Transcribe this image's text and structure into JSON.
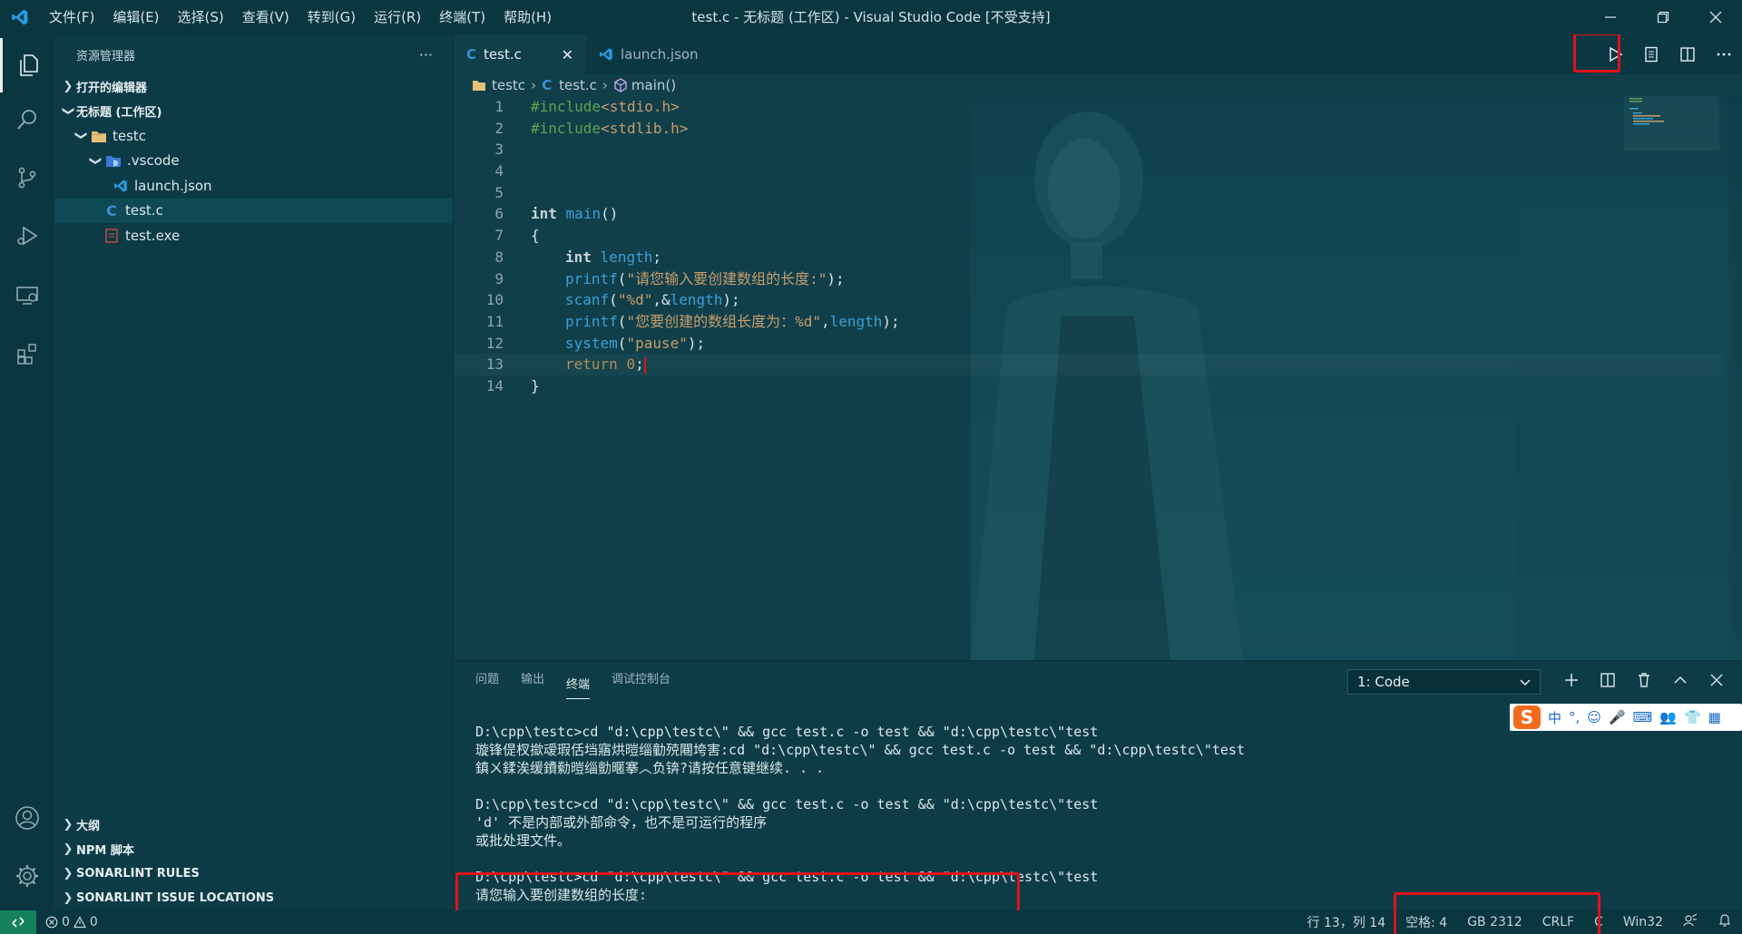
{
  "window": {
    "title": "test.c - 无标题 (工作区) - Visual Studio Code [不受支持]",
    "menu": [
      "文件(F)",
      "编辑(E)",
      "选择(S)",
      "查看(V)",
      "转到(G)",
      "运行(R)",
      "终端(T)",
      "帮助(H)"
    ]
  },
  "activity_bar": {
    "items": [
      "explorer-icon",
      "search-icon",
      "source-control-icon",
      "run-debug-icon",
      "remote-explorer-icon",
      "extensions-icon"
    ],
    "bottom": [
      "account-icon",
      "settings-gear-icon"
    ]
  },
  "sidebar": {
    "title": "资源管理器",
    "more": "···",
    "open_editors": "打开的编辑器",
    "workspace": "无标题 (工作区)",
    "tree": [
      {
        "label": "testc",
        "icon": "folder-icon"
      },
      {
        "label": ".vscode",
        "icon": "vscode-folder-icon"
      },
      {
        "label": "launch.json",
        "icon": "vscode-file-icon"
      },
      {
        "label": "test.c",
        "icon": "c-file-icon"
      },
      {
        "label": "test.exe",
        "icon": "exe-file-icon"
      }
    ],
    "bottom_sections": [
      "大纲",
      "NPM 脚本",
      "SONARLINT RULES",
      "SONARLINT ISSUE LOCATIONS"
    ]
  },
  "tabs": [
    {
      "label": "test.c",
      "active": true,
      "close": "✕"
    },
    {
      "label": "launch.json",
      "active": false
    }
  ],
  "breadcrumb": [
    "testc",
    "test.c",
    "main()"
  ],
  "code": {
    "lines": [
      {
        "n": "1"
      },
      {
        "n": "2"
      },
      {
        "n": "3"
      },
      {
        "n": "4"
      },
      {
        "n": "5"
      },
      {
        "n": "6"
      },
      {
        "n": "7"
      },
      {
        "n": "8"
      },
      {
        "n": "9"
      },
      {
        "n": "10"
      },
      {
        "n": "11"
      },
      {
        "n": "12"
      },
      {
        "n": "13"
      },
      {
        "n": "14"
      }
    ],
    "l1": {
      "a": "#include",
      "b": "<stdio.h>"
    },
    "l2": {
      "a": "#include",
      "b": "<stdlib.h>"
    },
    "l6": {
      "a": "int",
      "b": " ",
      "c": "main",
      "d": "()"
    },
    "l7": "{",
    "l8": {
      "a": "int",
      "b": " ",
      "c": "length",
      "d": ";"
    },
    "l9": {
      "a": "printf",
      "b": "(",
      "c": "\"请您输入要创建数组的长度:\"",
      "d": ");"
    },
    "l10": {
      "a": "scanf",
      "b": "(",
      "c": "\"%d\"",
      "d": ",&",
      "e": "length",
      "f": ");"
    },
    "l11": {
      "a": "printf",
      "b": "(",
      "c": "\"您要创建的数组长度为：%d\"",
      "d": ",",
      "e": "length",
      "f": ");"
    },
    "l12": {
      "a": "system",
      "b": "(",
      "c": "\"pause\"",
      "d": ");"
    },
    "l13": {
      "a": "return",
      "b": " ",
      "c": "0",
      "d": ";"
    },
    "l14": "}"
  },
  "panel": {
    "tabs": [
      "问题",
      "输出",
      "终端",
      "调试控制台"
    ],
    "active_tab": "终端",
    "terminal_select": "1: Code",
    "terminal_lines": [
      "D:\\cpp\\testc>cd \"d:\\cpp\\testc\\\" && gcc test.c -o test && \"d:\\cpp\\testc\\\"test",
      "璇锋偍杈撳叆瑕佸垱寤烘暟缁勭殑闀垮害:cd \"d:\\cpp\\testc\\\" && gcc test.c -o test && \"d:\\cpp\\testc\\\"test",
      "鎮ㄨ鍒涘缓鐨勬暟缁勯暱搴︿负锛?请按任意键继续. . .",
      "",
      "D:\\cpp\\testc>cd \"d:\\cpp\\testc\\\" && gcc test.c -o test && \"d:\\cpp\\testc\\\"test",
      "'d' 不是内部或外部命令，也不是可运行的程序",
      "或批处理文件。",
      "",
      "D:\\cpp\\testc>cd \"d:\\cpp\\testc\\\" && gcc test.c -o test && \"d:\\cpp\\testc\\\"test",
      "请您输入要创建数组的长度:"
    ]
  },
  "ime": {
    "logo": "S",
    "items": [
      "中",
      "°,",
      "☺",
      "🎤",
      "⌨",
      "👥",
      "👕",
      "▦"
    ]
  },
  "statusbar": {
    "problems": {
      "errors": "0",
      "warnings": "0"
    },
    "position": "行 13，列 14",
    "spaces": "空格: 4",
    "encoding": "GB 2312",
    "eol": "CRLF",
    "lang": "C",
    "platform": "Win32"
  },
  "colors": {
    "accent_red": "#e0121b",
    "remote_green": "#16825d",
    "background": "#0b3a45"
  }
}
